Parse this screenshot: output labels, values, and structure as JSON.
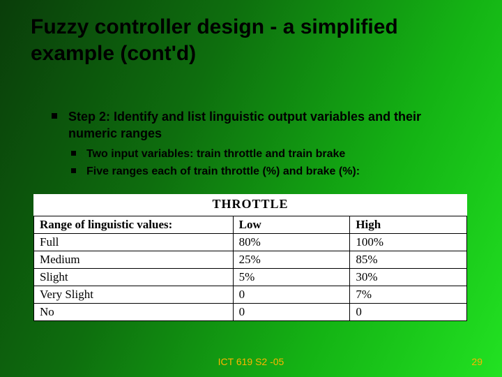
{
  "title": "Fuzzy controller design - a simplified example (cont'd)",
  "bullets": {
    "step": "Step 2: Identify and list linguistic output variables and their numeric ranges",
    "sub1": "Two input variables: train throttle and train brake",
    "sub2": "Five ranges each of train throttle (%) and brake (%):"
  },
  "table": {
    "caption": "THROTTLE",
    "head": {
      "c1": "Range of linguistic values:",
      "c2": "Low",
      "c3": "High"
    },
    "rows": [
      {
        "c1": "Full",
        "c2": "80%",
        "c3": "100%"
      },
      {
        "c1": "Medium",
        "c2": "25%",
        "c3": "85%"
      },
      {
        "c1": "Slight",
        "c2": "5%",
        "c3": "30%"
      },
      {
        "c1": "Very Slight",
        "c2": "0",
        "c3": "7%"
      },
      {
        "c1": "No",
        "c2": "0",
        "c3": "0"
      }
    ]
  },
  "footer": {
    "center": "ICT 619 S2 -05",
    "page": "29"
  }
}
